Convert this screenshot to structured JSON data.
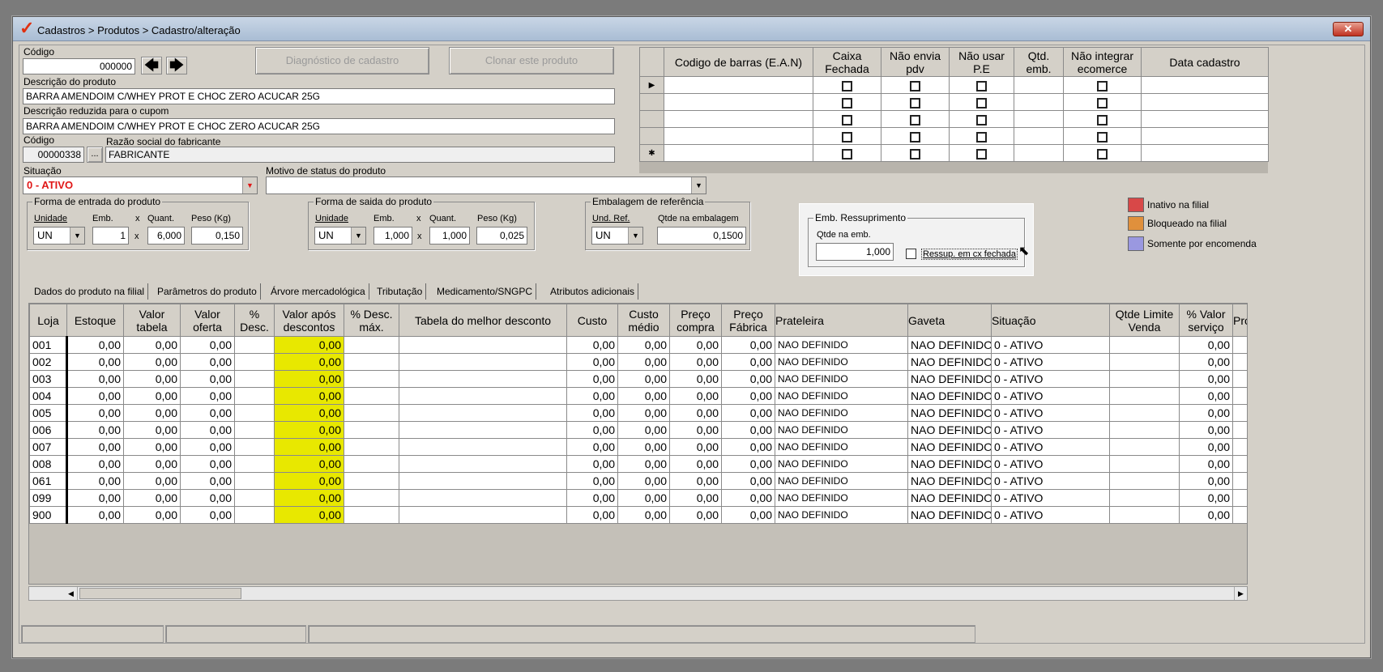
{
  "window": {
    "title": "Cadastros > Produtos > Cadastro/alteração",
    "close_label": "✕"
  },
  "form": {
    "codigo_label": "Código",
    "codigo_value": "000000",
    "diag_button": "Diagnóstico de cadastro",
    "clone_button": "Clonar este produto",
    "descricao_label": "Descrição  do produto",
    "descricao_value": "BARRA AMENDOIM C/WHEY PROT E CHOC ZERO ACUCAR 25G",
    "descricao_reduzida_label": "Descrição reduzida para o cupom",
    "descricao_reduzida_value": "BARRA AMENDOIM C/WHEY PROT E CHOC ZERO ACUCAR 25G",
    "fab_codigo_label": "Código",
    "fab_codigo_value": "00000338",
    "fab_ellipsis": "...",
    "razao_label": "Razão social do fabricante",
    "razao_value": "FABRICANTE",
    "situacao_label": "Situação",
    "situacao_value": "0 - ATIVO",
    "motivo_label": "Motivo de status do produto",
    "motivo_value": ""
  },
  "entrada": {
    "title": "Forma de entrada do produto",
    "unidade_label": "Unidade",
    "emb_label": "Emb.",
    "x": "x",
    "quant_label": "Quant.",
    "peso_label": "Peso (Kg)",
    "unidade": "UN",
    "emb": "1",
    "quant": "6,000",
    "peso": "0,150"
  },
  "saida": {
    "title": "Forma de saida do produto",
    "unidade_label": "Unidade",
    "emb_label": "Emb.",
    "x": "x",
    "quant_label": "Quant.",
    "peso_label": "Peso (Kg)",
    "unidade": "UN",
    "emb": "1,000",
    "quant": "1,000",
    "peso": "0,025"
  },
  "embalagem_ref": {
    "title": "Embalagem de referência",
    "und_label": "Und. Ref.",
    "qtde_label": "Qtde na embalagem",
    "und": "UN",
    "qtde": "0,1500"
  },
  "ressup": {
    "title": "Emb. Ressuprimento",
    "qtde_label": "Qtde na emb.",
    "qtde": "1,000",
    "check_label": "Ressup. em cx fechada"
  },
  "legend": [
    {
      "label": "Inativo na filial",
      "color": "#d84848"
    },
    {
      "label": "Bloqueado na filial",
      "color": "#e0903c"
    },
    {
      "label": "Somente por encomenda",
      "color": "#9a98e0"
    }
  ],
  "ean_table": {
    "headers": [
      "Codigo de barras (E.A.N)",
      "Caixa Fechada",
      "Não envia pdv",
      "Não usar P.E",
      "Qtd. emb.",
      "Não integrar ecomerce",
      "Data cadastro"
    ],
    "row_indicators": [
      "▶",
      "",
      "",
      "",
      "✱"
    ]
  },
  "tabs": [
    "Dados do produto na filial",
    "Parâmetros do produto",
    "Árvore mercadológica",
    "Tributação",
    "Medicamento/SNGPC",
    "Atributos adicionais"
  ],
  "grid": {
    "headers": [
      "Loja",
      "Estoque",
      "Valor tabela",
      "Valor oferta",
      "% Desc.",
      "Valor após descontos",
      "% Desc. máx.",
      "Tabela do melhor desconto",
      "Custo",
      "Custo médio",
      "Preço compra",
      "Preço Fábrica",
      "Prateleira",
      "Gaveta",
      "Situação",
      "Qtde Limite Venda",
      "% Valor serviço",
      "Proj"
    ],
    "rows": [
      {
        "loja": "001",
        "estoque": "0,00",
        "vtab": "0,00",
        "voferta": "0,00",
        "desc": "",
        "vapos": "0,00",
        "descmax": "",
        "tabela": "",
        "custo": "0,00",
        "cmedio": "0,00",
        "pcompra": "0,00",
        "pfab": "0,00",
        "prat": "NAO DEFINIDO",
        "gaveta": "NAO DEFINIDO",
        "sit": "0 - ATIVO",
        "qlim": "",
        "vserv": "0,00"
      },
      {
        "loja": "002",
        "estoque": "0,00",
        "vtab": "0,00",
        "voferta": "0,00",
        "desc": "",
        "vapos": "0,00",
        "descmax": "",
        "tabela": "",
        "custo": "0,00",
        "cmedio": "0,00",
        "pcompra": "0,00",
        "pfab": "0,00",
        "prat": "NAO DEFINIDO",
        "gaveta": "NAO DEFINIDO",
        "sit": "0 - ATIVO",
        "qlim": "",
        "vserv": "0,00"
      },
      {
        "loja": "003",
        "estoque": "0,00",
        "vtab": "0,00",
        "voferta": "0,00",
        "desc": "",
        "vapos": "0,00",
        "descmax": "",
        "tabela": "",
        "custo": "0,00",
        "cmedio": "0,00",
        "pcompra": "0,00",
        "pfab": "0,00",
        "prat": "NAO DEFINIDO",
        "gaveta": "NAO DEFINIDO",
        "sit": "0 - ATIVO",
        "qlim": "",
        "vserv": "0,00"
      },
      {
        "loja": "004",
        "estoque": "0,00",
        "vtab": "0,00",
        "voferta": "0,00",
        "desc": "",
        "vapos": "0,00",
        "descmax": "",
        "tabela": "",
        "custo": "0,00",
        "cmedio": "0,00",
        "pcompra": "0,00",
        "pfab": "0,00",
        "prat": "NAO DEFINIDO",
        "gaveta": "NAO DEFINIDO",
        "sit": "0 - ATIVO",
        "qlim": "",
        "vserv": "0,00"
      },
      {
        "loja": "005",
        "estoque": "0,00",
        "vtab": "0,00",
        "voferta": "0,00",
        "desc": "",
        "vapos": "0,00",
        "descmax": "",
        "tabela": "",
        "custo": "0,00",
        "cmedio": "0,00",
        "pcompra": "0,00",
        "pfab": "0,00",
        "prat": "NAO DEFINIDO",
        "gaveta": "NAO DEFINIDO",
        "sit": "0 - ATIVO",
        "qlim": "",
        "vserv": "0,00"
      },
      {
        "loja": "006",
        "estoque": "0,00",
        "vtab": "0,00",
        "voferta": "0,00",
        "desc": "",
        "vapos": "0,00",
        "descmax": "",
        "tabela": "",
        "custo": "0,00",
        "cmedio": "0,00",
        "pcompra": "0,00",
        "pfab": "0,00",
        "prat": "NAO DEFINIDO",
        "gaveta": "NAO DEFINIDO",
        "sit": "0 - ATIVO",
        "qlim": "",
        "vserv": "0,00"
      },
      {
        "loja": "007",
        "estoque": "0,00",
        "vtab": "0,00",
        "voferta": "0,00",
        "desc": "",
        "vapos": "0,00",
        "descmax": "",
        "tabela": "",
        "custo": "0,00",
        "cmedio": "0,00",
        "pcompra": "0,00",
        "pfab": "0,00",
        "prat": "NAO DEFINIDO",
        "gaveta": "NAO DEFINIDO",
        "sit": "0 - ATIVO",
        "qlim": "",
        "vserv": "0,00"
      },
      {
        "loja": "008",
        "estoque": "0,00",
        "vtab": "0,00",
        "voferta": "0,00",
        "desc": "",
        "vapos": "0,00",
        "descmax": "",
        "tabela": "",
        "custo": "0,00",
        "cmedio": "0,00",
        "pcompra": "0,00",
        "pfab": "0,00",
        "prat": "NAO DEFINIDO",
        "gaveta": "NAO DEFINIDO",
        "sit": "0 - ATIVO",
        "qlim": "",
        "vserv": "0,00"
      },
      {
        "loja": "061",
        "estoque": "0,00",
        "vtab": "0,00",
        "voferta": "0,00",
        "desc": "",
        "vapos": "0,00",
        "descmax": "",
        "tabela": "",
        "custo": "0,00",
        "cmedio": "0,00",
        "pcompra": "0,00",
        "pfab": "0,00",
        "prat": "NAO DEFINIDO",
        "gaveta": "NAO DEFINIDO",
        "sit": "0 - ATIVO",
        "qlim": "",
        "vserv": "0,00"
      },
      {
        "loja": "099",
        "estoque": "0,00",
        "vtab": "0,00",
        "voferta": "0,00",
        "desc": "",
        "vapos": "0,00",
        "descmax": "",
        "tabela": "",
        "custo": "0,00",
        "cmedio": "0,00",
        "pcompra": "0,00",
        "pfab": "0,00",
        "prat": "NAO DEFINIDO",
        "gaveta": "NAO DEFINIDO",
        "sit": "0 - ATIVO",
        "qlim": "",
        "vserv": "0,00"
      },
      {
        "loja": "900",
        "estoque": "0,00",
        "vtab": "0,00",
        "voferta": "0,00",
        "desc": "",
        "vapos": "0,00",
        "descmax": "",
        "tabela": "",
        "custo": "0,00",
        "cmedio": "0,00",
        "pcompra": "0,00",
        "pfab": "0,00",
        "prat": "NAO DEFINIDO",
        "gaveta": "NAO DEFINIDO",
        "sit": "0 - ATIVO",
        "qlim": "",
        "vserv": "0,00"
      }
    ]
  },
  "icons": {
    "left_arrow": "arrow-left-icon",
    "right_arrow": "arrow-right-icon",
    "dropdown": "chevron-down-icon"
  }
}
